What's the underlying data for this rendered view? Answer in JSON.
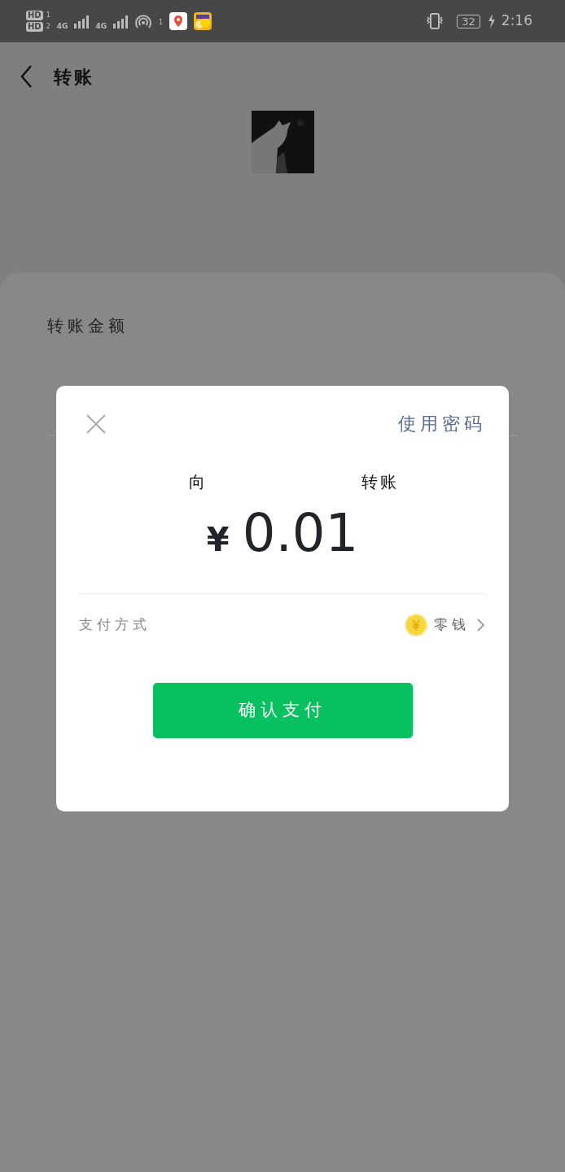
{
  "status_bar": {
    "sim_slots": [
      {
        "label": "HD",
        "number": "1"
      },
      {
        "label": "HD",
        "number": "2"
      }
    ],
    "network_labels": [
      "4G",
      "4G"
    ],
    "notification_count": "1",
    "battery": "32",
    "time": "2:16"
  },
  "header": {
    "title": "转账"
  },
  "transfer_form": {
    "amount_label": "转账金额"
  },
  "payment_dialog": {
    "use_password_link": "使用密码",
    "recipient_prefix": "向",
    "recipient_suffix": "转账",
    "currency": "¥",
    "amount": "0.01",
    "payment_method_label": "支付方式",
    "payment_method": "零钱",
    "confirm_button": "确认支付"
  }
}
